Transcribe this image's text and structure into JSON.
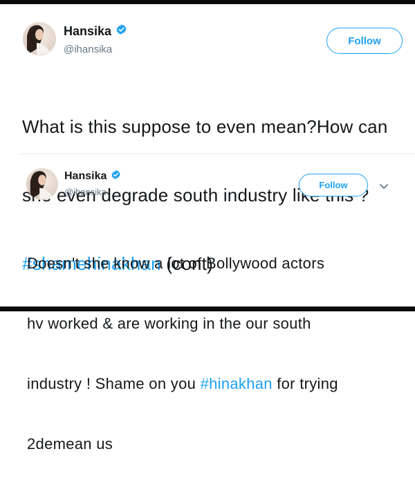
{
  "colors": {
    "link_blue": "#1da1f2",
    "text_dark": "#14171a",
    "text_gray": "#657786",
    "frame": "#0a0a0a"
  },
  "tweet1": {
    "user": {
      "name": "Hansika",
      "handle": "@ihansika",
      "verified_icon": "verified-badge-icon"
    },
    "follow_label": "Follow",
    "lines": [
      {
        "text": "What is this suppose to  even mean?How can"
      },
      {
        "text": "she even degrade south industry like this ?"
      },
      {
        "hashtag": "#shamehinakhan",
        "suffix": " (cont)"
      }
    ]
  },
  "tweet2": {
    "user": {
      "name": "Hansika",
      "handle": "@ihansika",
      "verified_icon": "verified-badge-icon"
    },
    "follow_label": "Follow",
    "more_icon": "chevron-down-icon",
    "lines": [
      {
        "text": "Doesn't she know a lot of Bollywood actors"
      },
      {
        "text": "hv worked & are working in the our south"
      },
      {
        "prefix": "industry ! Shame on you ",
        "hashtag": "#hinakhan",
        "suffix": " for trying"
      },
      {
        "text": "2demean us"
      }
    ]
  }
}
